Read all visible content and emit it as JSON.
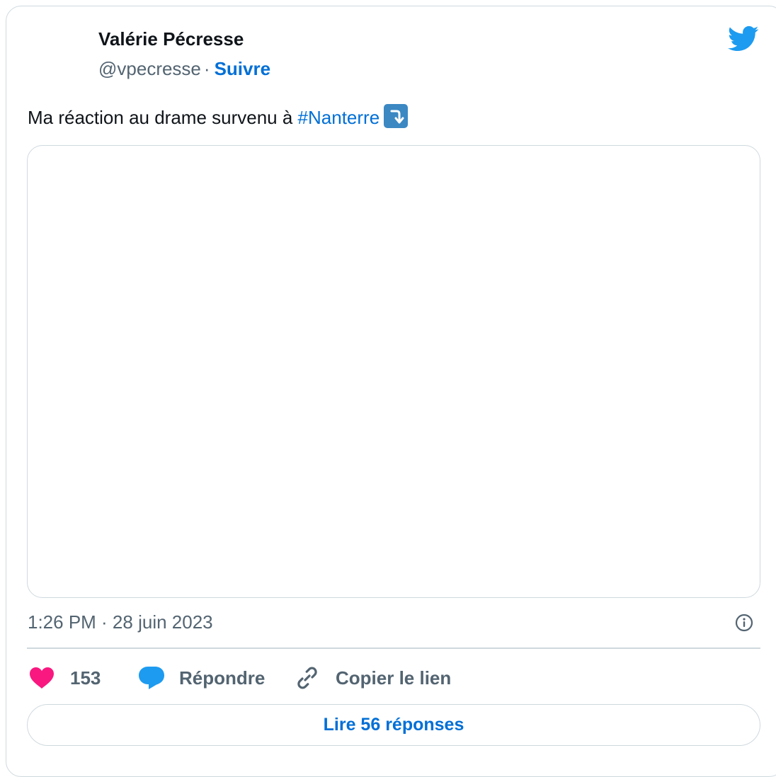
{
  "author": {
    "name": "Valérie Pécresse",
    "handle": "@vpecresse",
    "separator": "·",
    "follow_label": "Suivre"
  },
  "tweet": {
    "text": "Ma réaction au drame survenu à ",
    "hashtag": "#Nanterre",
    "emoji_icon": "right-arrow-curving-down-icon",
    "media_icon": "embedded-media-area"
  },
  "meta": {
    "timestamp": "1:26 PM · 28 juin 2023",
    "info_icon": "info-icon"
  },
  "actions": {
    "like_count": "153",
    "reply_label": "Répondre",
    "copy_label": "Copier le lien"
  },
  "read_replies_label": "Lire 56 réponses",
  "colors": {
    "accent_blue": "#006fd6",
    "twitter_blue": "#1d9bf0",
    "like_pink": "#f91880",
    "text_primary": "#0f1419",
    "text_secondary": "#536471",
    "border": "#cfd9de"
  }
}
